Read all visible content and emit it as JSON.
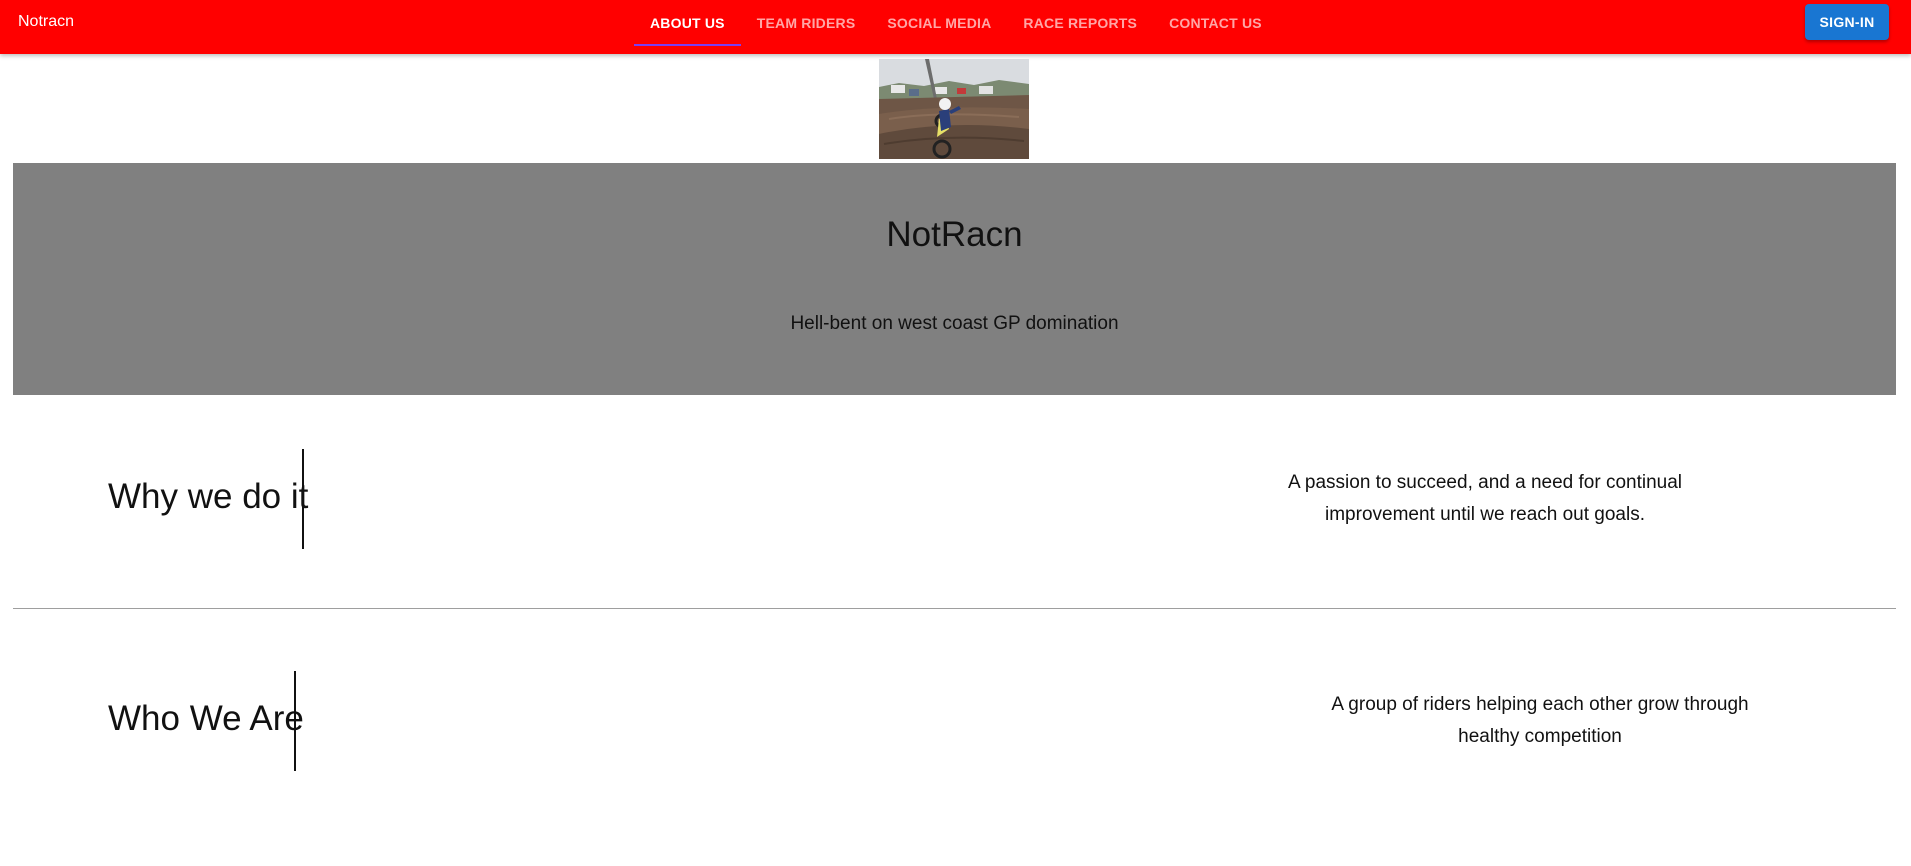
{
  "header": {
    "brand": "Notracn",
    "tabs": [
      {
        "label": "ABOUT US",
        "active": true
      },
      {
        "label": "TEAM RIDERS",
        "active": false
      },
      {
        "label": "SOCIAL MEDIA",
        "active": false
      },
      {
        "label": "RACE REPORTS",
        "active": false
      },
      {
        "label": "CONTACT US",
        "active": false
      }
    ],
    "signin_label": "SIGN-IN"
  },
  "banner": {
    "title": "NotRacn",
    "subtitle": "Hell-bent on west coast GP domination"
  },
  "sections": [
    {
      "heading": "Why we do it",
      "text": "A passion to succeed, and a need for continual improvement until we reach out goals."
    },
    {
      "heading": "Who We Are",
      "text": "A group of riders helping each other grow through healthy competition"
    }
  ],
  "colors": {
    "appbar": "#ff0000",
    "banner": "#808080",
    "signin_button": "#1976d2",
    "active_tab_indicator": "#7b3ff2"
  },
  "icons": {
    "hero_image": "motocross-rider-image"
  }
}
